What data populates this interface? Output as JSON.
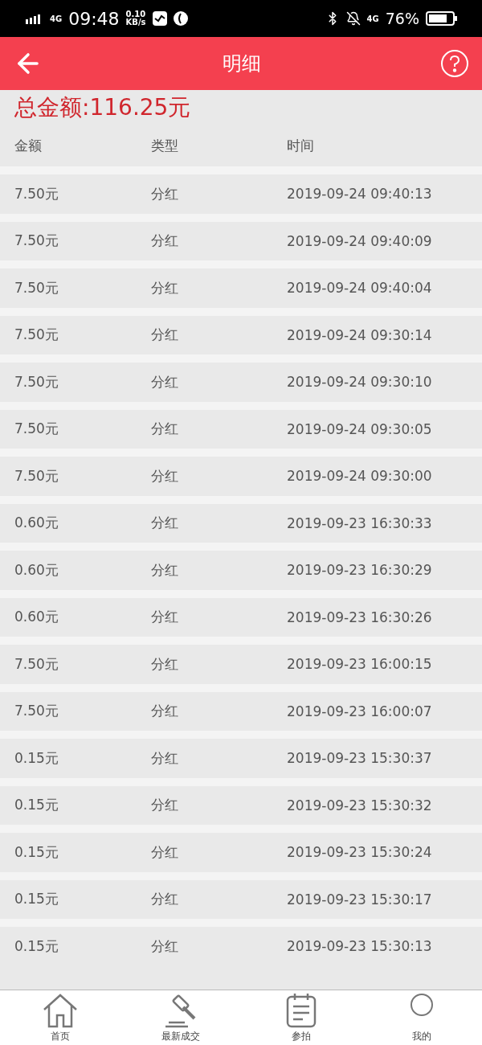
{
  "status_bar": {
    "network": "4G",
    "time": "09:48",
    "speed_value": "0.10",
    "speed_unit": "KB/s",
    "data_network": "4G",
    "battery": "76%"
  },
  "header": {
    "title": "明细"
  },
  "total": "总金额:116.25元",
  "table": {
    "columns": [
      "金额",
      "类型",
      "时间"
    ],
    "rows": [
      [
        "7.50元",
        "分红",
        "2019-09-24 09:40:13"
      ],
      [
        "7.50元",
        "分红",
        "2019-09-24 09:40:09"
      ],
      [
        "7.50元",
        "分红",
        "2019-09-24 09:40:04"
      ],
      [
        "7.50元",
        "分红",
        "2019-09-24 09:30:14"
      ],
      [
        "7.50元",
        "分红",
        "2019-09-24 09:30:10"
      ],
      [
        "7.50元",
        "分红",
        "2019-09-24 09:30:05"
      ],
      [
        "7.50元",
        "分红",
        "2019-09-24 09:30:00"
      ],
      [
        "0.60元",
        "分红",
        "2019-09-23 16:30:33"
      ],
      [
        "0.60元",
        "分红",
        "2019-09-23 16:30:29"
      ],
      [
        "0.60元",
        "分红",
        "2019-09-23 16:30:26"
      ],
      [
        "7.50元",
        "分红",
        "2019-09-23 16:00:15"
      ],
      [
        "7.50元",
        "分红",
        "2019-09-23 16:00:07"
      ],
      [
        "0.15元",
        "分红",
        "2019-09-23 15:30:37"
      ],
      [
        "0.15元",
        "分红",
        "2019-09-23 15:30:32"
      ],
      [
        "0.15元",
        "分红",
        "2019-09-23 15:30:24"
      ],
      [
        "0.15元",
        "分红",
        "2019-09-23 15:30:17"
      ],
      [
        "0.15元",
        "分红",
        "2019-09-23 15:30:13"
      ]
    ]
  },
  "bottom_nav": [
    {
      "kind": "home",
      "label": "首页",
      "selected": false
    },
    {
      "kind": "gavel",
      "label": "最新成交",
      "selected": false
    },
    {
      "kind": "clipboard",
      "label": "参拍",
      "selected": false
    },
    {
      "kind": "profile",
      "label": "我的",
      "selected": false
    }
  ]
}
